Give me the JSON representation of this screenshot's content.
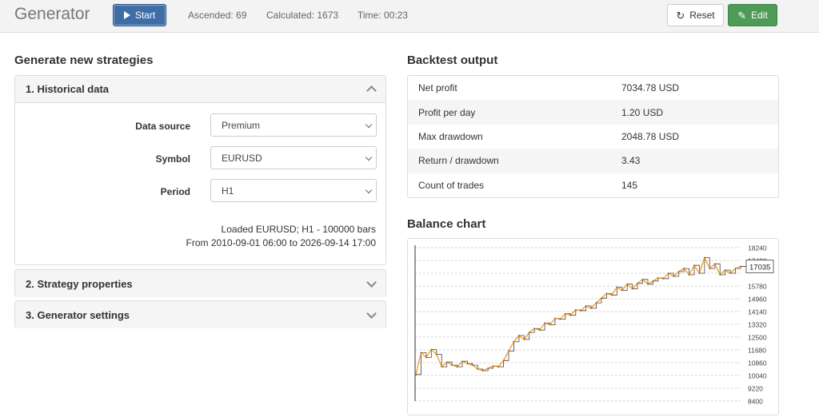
{
  "app": {
    "title": "Generator"
  },
  "toolbar": {
    "start_label": "Start",
    "ascended": "Ascended: 69",
    "calculated": "Calculated: 1673",
    "time": "Time: 00:23",
    "reset_label": "Reset",
    "edit_label": "Edit"
  },
  "left": {
    "title": "Generate new strategies",
    "panels": [
      {
        "label": "1. Historical data",
        "expanded": true
      },
      {
        "label": "2. Strategy properties",
        "expanded": false
      },
      {
        "label": "3. Generator settings",
        "expanded": false
      }
    ],
    "historical": {
      "data_source_label": "Data source",
      "data_source_value": "Premium",
      "symbol_label": "Symbol",
      "symbol_value": "EURUSD",
      "period_label": "Period",
      "period_value": "H1",
      "loaded_line1": "Loaded EURUSD; H1 - 100000 bars",
      "loaded_line2": "From 2010-09-01 06:00 to 2026-09-14 17:00"
    }
  },
  "backtest": {
    "title": "Backtest output",
    "rows": [
      {
        "label": "Net profit",
        "value": "7034.78 USD"
      },
      {
        "label": "Profit per day",
        "value": "1.20 USD"
      },
      {
        "label": "Max drawdown",
        "value": "2048.78 USD"
      },
      {
        "label": "Return / drawdown",
        "value": "3.43"
      },
      {
        "label": "Count of trades",
        "value": "145"
      }
    ]
  },
  "chart_data": {
    "type": "line",
    "title": "Balance chart",
    "xlabel": "",
    "ylabel": "",
    "ylim": [
      8400,
      18240
    ],
    "y_ticks": [
      18240,
      17420,
      16600,
      15780,
      14960,
      14140,
      13320,
      12500,
      11680,
      10860,
      10040,
      9220,
      8400
    ],
    "y_tick_labels_visible": [
      "18240",
      "17420",
      "",
      "15780",
      "14960",
      "14140",
      "13320",
      "12500",
      "11680",
      "10860",
      "10040",
      "9220",
      "8400"
    ],
    "current_value_label": "17035",
    "current_value": 17035,
    "grid": true,
    "colors": {
      "line": "#f0a030",
      "step": "#444444"
    },
    "series": [
      {
        "values": [
          10100,
          11500,
          11200,
          11700,
          11400,
          10600,
          10900,
          10700,
          10600,
          10950,
          10800,
          10700,
          10450,
          10350,
          10500,
          10650,
          10600,
          11000,
          11600,
          12200,
          12600,
          12350,
          12800,
          13050,
          12950,
          13400,
          13300,
          13700,
          13650,
          14000,
          13900,
          14250,
          14200,
          14500,
          14350,
          14700,
          15000,
          15300,
          15200,
          15700,
          15500,
          15900,
          15600,
          15950,
          16200,
          15900,
          16100,
          16300,
          16250,
          16600,
          16400,
          16700,
          16900,
          16500,
          17100,
          16600,
          17600,
          16900,
          17200,
          16500,
          16800,
          16600,
          16900,
          17035
        ]
      }
    ]
  }
}
